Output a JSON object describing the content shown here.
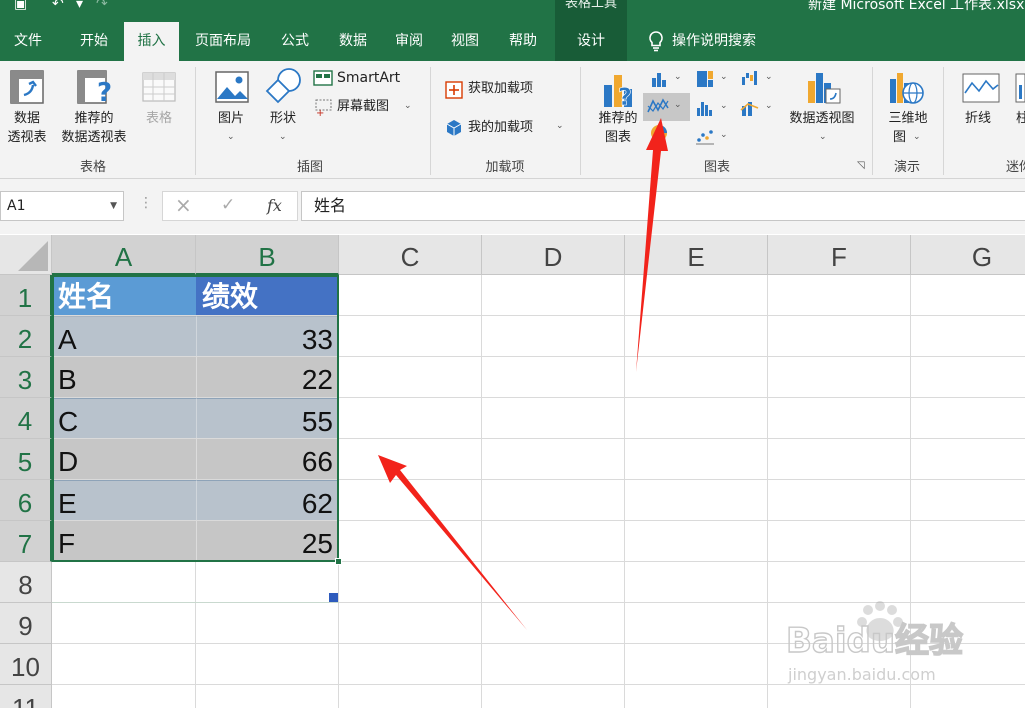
{
  "window": {
    "title": "新建 Microsoft Excel 工作表.xlsx",
    "context_header": "表格工具"
  },
  "tabs": [
    {
      "id": "file",
      "label": "文件"
    },
    {
      "id": "home",
      "label": "开始"
    },
    {
      "id": "insert",
      "label": "插入",
      "active": true
    },
    {
      "id": "page_layout",
      "label": "页面布局"
    },
    {
      "id": "formulas",
      "label": "公式"
    },
    {
      "id": "data",
      "label": "数据"
    },
    {
      "id": "review",
      "label": "审阅"
    },
    {
      "id": "view",
      "label": "视图"
    },
    {
      "id": "help",
      "label": "帮助"
    },
    {
      "id": "design",
      "label": "设计",
      "contextual": true
    }
  ],
  "search": {
    "label": "操作说明搜索",
    "icon": "lightbulb-icon"
  },
  "ribbon": {
    "groups": {
      "tables": "表格",
      "illustrations": "插图",
      "addins": "加载项",
      "charts": "图表",
      "tours": "演示",
      "sparklines": "迷你"
    },
    "tables": {
      "pivot_line1": "数据",
      "pivot_line2": "透视表",
      "rec_pivot_line1": "推荐的",
      "rec_pivot_line2": "数据透视表",
      "table": "表格"
    },
    "illustrations": {
      "pictures": "图片",
      "shapes": "形状",
      "smartart": "SmartArt",
      "screenshot": "屏幕截图"
    },
    "addins": {
      "get": "获取加载项",
      "my": "我的加载项"
    },
    "charts": {
      "recommended_line1": "推荐的",
      "recommended_line2": "图表",
      "pivotchart": "数据透视图"
    },
    "tours": {
      "map3d_line1": "三维地",
      "map3d_line2": "图"
    },
    "sparklines": {
      "line": "折线",
      "column_partial": "柱"
    }
  },
  "formula_bar": {
    "name_box": "A1",
    "cancel_icon": "×",
    "enter_icon": "✓",
    "fx": "fx",
    "content": "姓名"
  },
  "grid": {
    "columns": [
      "A",
      "B",
      "C",
      "D",
      "E",
      "F",
      "G"
    ],
    "rows": [
      "1",
      "2",
      "3",
      "4",
      "5",
      "6",
      "7",
      "8",
      "9",
      "10",
      "11"
    ],
    "header": [
      "姓名",
      "绩效"
    ],
    "data": [
      {
        "name": "A",
        "score": 33
      },
      {
        "name": "B",
        "score": 22
      },
      {
        "name": "C",
        "score": 55
      },
      {
        "name": "D",
        "score": 66
      },
      {
        "name": "E",
        "score": 62
      },
      {
        "name": "F",
        "score": 25
      }
    ],
    "colors": {
      "header_fill": "#5b9bd5",
      "band_fill": "#b8c2cc",
      "alt_fill": "#c6c6c6",
      "selection": "#217346"
    }
  },
  "annotations": {
    "arrow_color": "#f2231b"
  },
  "watermark": {
    "brand": "Baidu经验",
    "url": "jingyan.baidu.com"
  }
}
